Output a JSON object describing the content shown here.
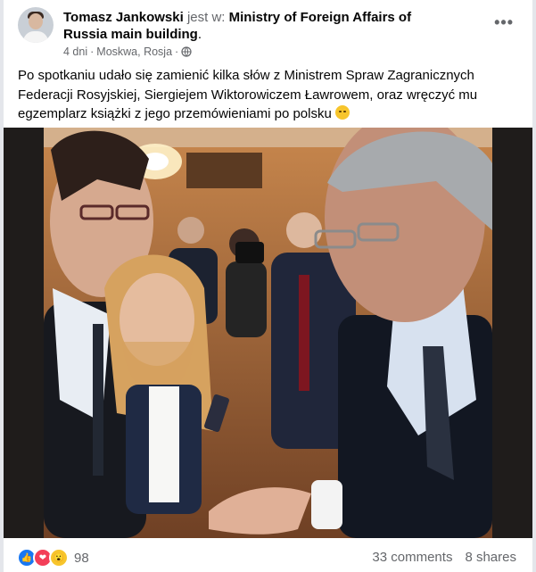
{
  "post": {
    "author": "Tomasz Jankowski",
    "at_text": " jest w: ",
    "place": "Ministry of Foreign Affairs of Russia main building",
    "place_suffix": ".",
    "time": "4 dni",
    "separator": " · ",
    "location": "Moskwa, Rosja",
    "separator2": " · ",
    "audience_icon": "globe-icon",
    "more_label": "•••",
    "text": "Po spotkaniu udało się zamienić kilka słów z Ministrem Spraw Zagranicznych Federacji Rosyjskiej, Siergiejem Wiktorowiczem Ławrowem, oraz wręczyć mu egzemplarz książki z jego przemówieniami po polsku",
    "emoji": "smiling-face-emoji"
  },
  "reactions": {
    "types": [
      "like",
      "love",
      "wow"
    ],
    "count": "98"
  },
  "stats": {
    "comments": "33 comments",
    "shares": "8 shares"
  },
  "colors": {
    "link": "#050505",
    "secondary": "#65676b",
    "like": "#1877f2",
    "love": "#f33e58",
    "wow": "#f7c52c"
  }
}
